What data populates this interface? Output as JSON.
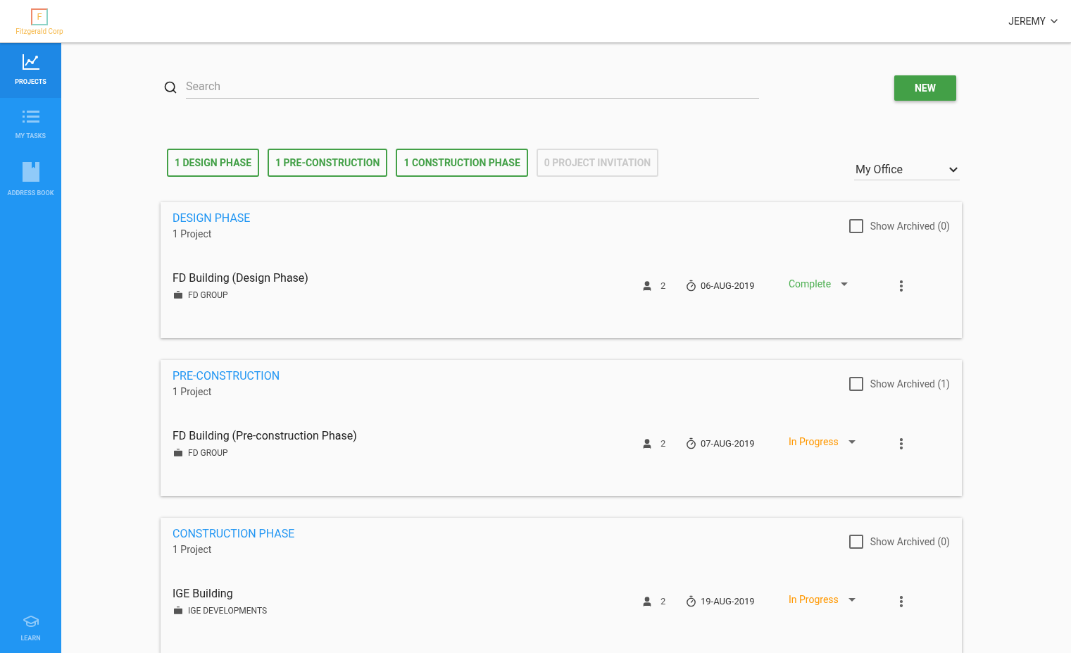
{
  "logo": {
    "letter": "F",
    "name": "Fitzgerald Corp"
  },
  "user": {
    "name": "JEREMY"
  },
  "sidebar": {
    "items": [
      {
        "label": "PROJECTS",
        "kind": "chart",
        "selected": true
      },
      {
        "label": "MY TASKS",
        "kind": "list",
        "selected": false
      },
      {
        "label": "ADDRESS BOOK",
        "kind": "book",
        "selected": false
      }
    ],
    "bottom": {
      "label": "LEARN",
      "kind": "cap"
    }
  },
  "search": {
    "placeholder": "Search"
  },
  "new_button": "NEW",
  "filters": [
    {
      "label": "1 DESIGN PHASE",
      "disabled": false
    },
    {
      "label": "1 PRE-CONSTRUCTION",
      "disabled": false
    },
    {
      "label": "1 CONSTRUCTION PHASE",
      "disabled": false
    },
    {
      "label": "0 PROJECT INVITATION",
      "disabled": true
    }
  ],
  "office_select": {
    "value": "My Office"
  },
  "sections": [
    {
      "title": "DESIGN PHASE",
      "count": "1 Project",
      "show_archived": {
        "label": "Show Archived (0)",
        "checked": false
      },
      "projects": [
        {
          "name": "FD Building (Design Phase)",
          "group": "FD GROUP",
          "members": "2",
          "date": "06-AUG-2019",
          "status": {
            "label": "Complete",
            "kind": "complete"
          }
        }
      ]
    },
    {
      "title": "PRE-CONSTRUCTION",
      "count": "1 Project",
      "show_archived": {
        "label": "Show Archived (1)",
        "checked": false
      },
      "projects": [
        {
          "name": "FD Building (Pre-construction Phase)",
          "group": "FD GROUP",
          "members": "2",
          "date": "07-AUG-2019",
          "status": {
            "label": "In Progress",
            "kind": "in_progress"
          }
        }
      ]
    },
    {
      "title": "CONSTRUCTION PHASE",
      "count": "1 Project",
      "show_archived": {
        "label": "Show Archived (0)",
        "checked": false
      },
      "projects": [
        {
          "name": "IGE Building",
          "group": "IGE DEVELOPMENTS",
          "members": "2",
          "date": "19-AUG-2019",
          "status": {
            "label": "In Progress",
            "kind": "in_progress"
          }
        }
      ]
    }
  ]
}
